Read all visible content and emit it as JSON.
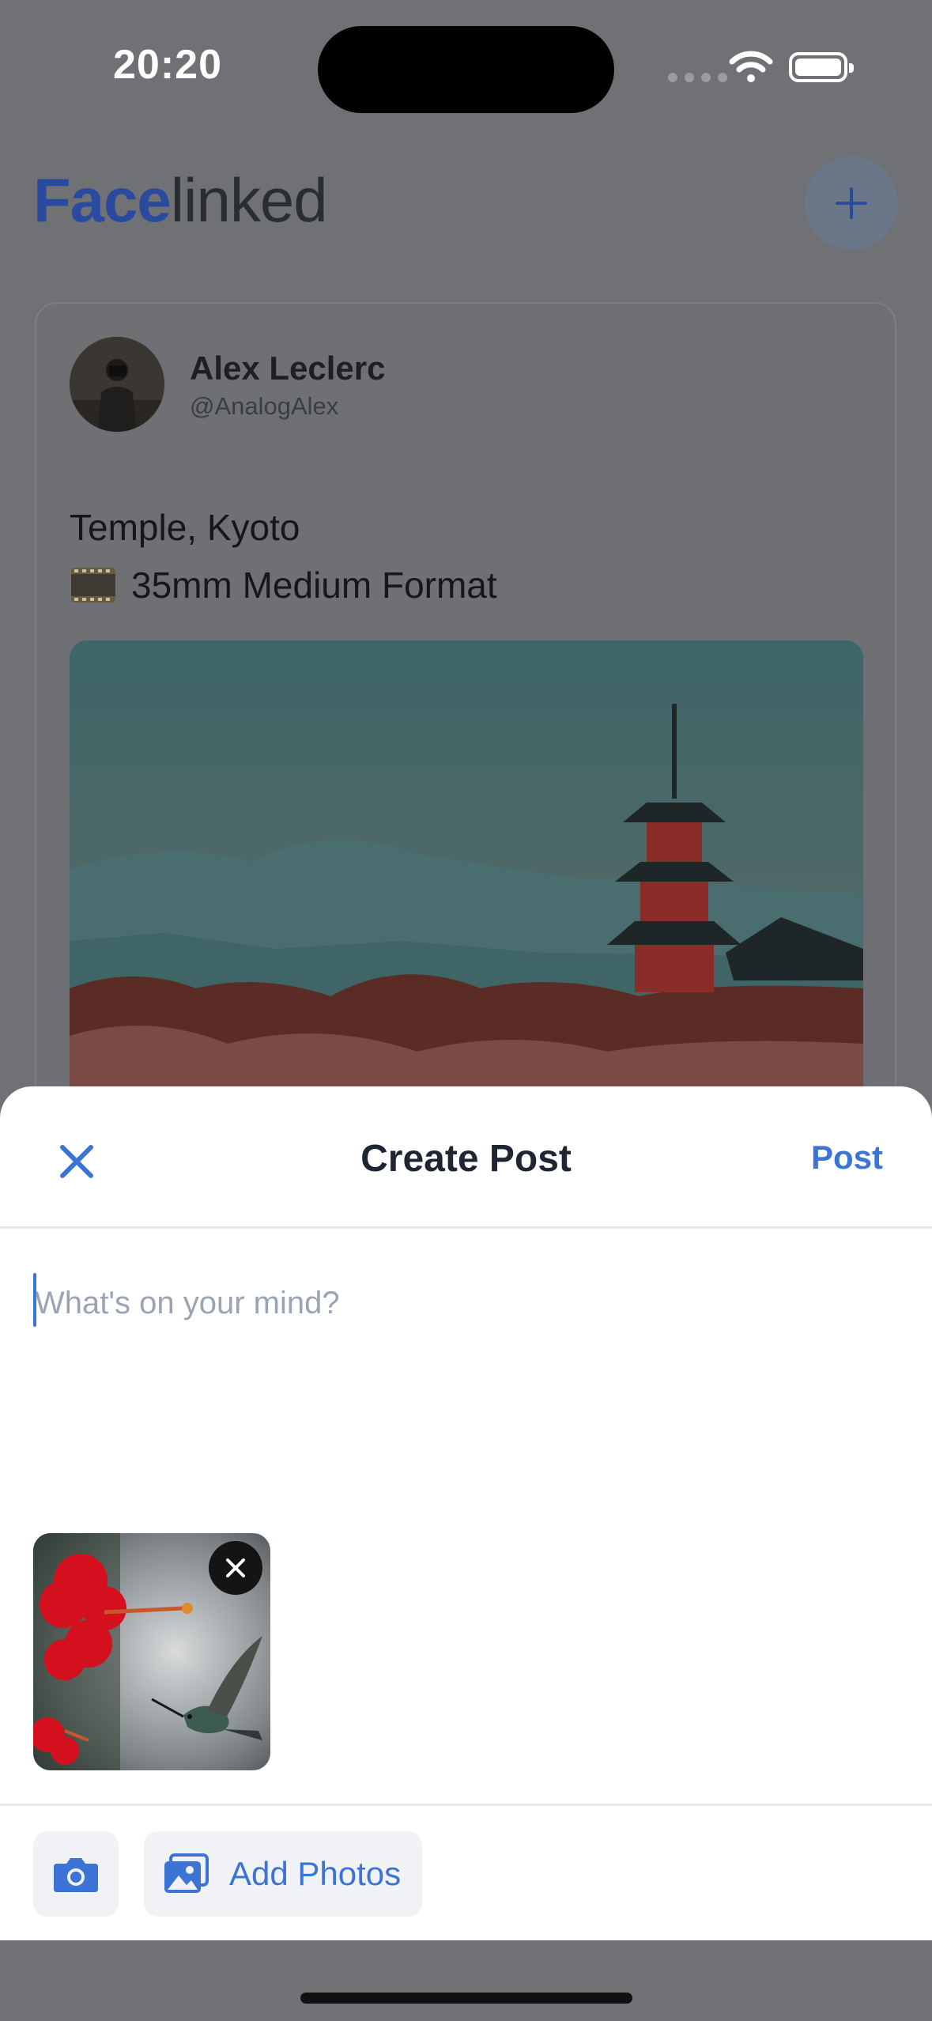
{
  "status_bar": {
    "time": "20:20"
  },
  "app": {
    "logo_bold": "Face",
    "logo_light": "linked"
  },
  "post": {
    "author_name": "Alex Leclerc",
    "author_handle": "@AnalogAlex",
    "title": "Temple, Kyoto",
    "format": "35mm Medium Format"
  },
  "sheet": {
    "title": "Create Post",
    "post_label": "Post",
    "composer_placeholder": "What's on your mind?",
    "composer_value": "",
    "add_photos_label": "Add Photos"
  },
  "colors": {
    "accent": "#3b74d4",
    "logo_blue": "#2a4a9f",
    "scrim": "#6f7174"
  },
  "icons": {
    "close": "close-icon",
    "camera": "camera-icon",
    "photo": "photo-icon",
    "remove_attachment": "remove-icon",
    "add": "plus-icon",
    "wifi": "wifi-icon",
    "battery": "battery-icon"
  }
}
